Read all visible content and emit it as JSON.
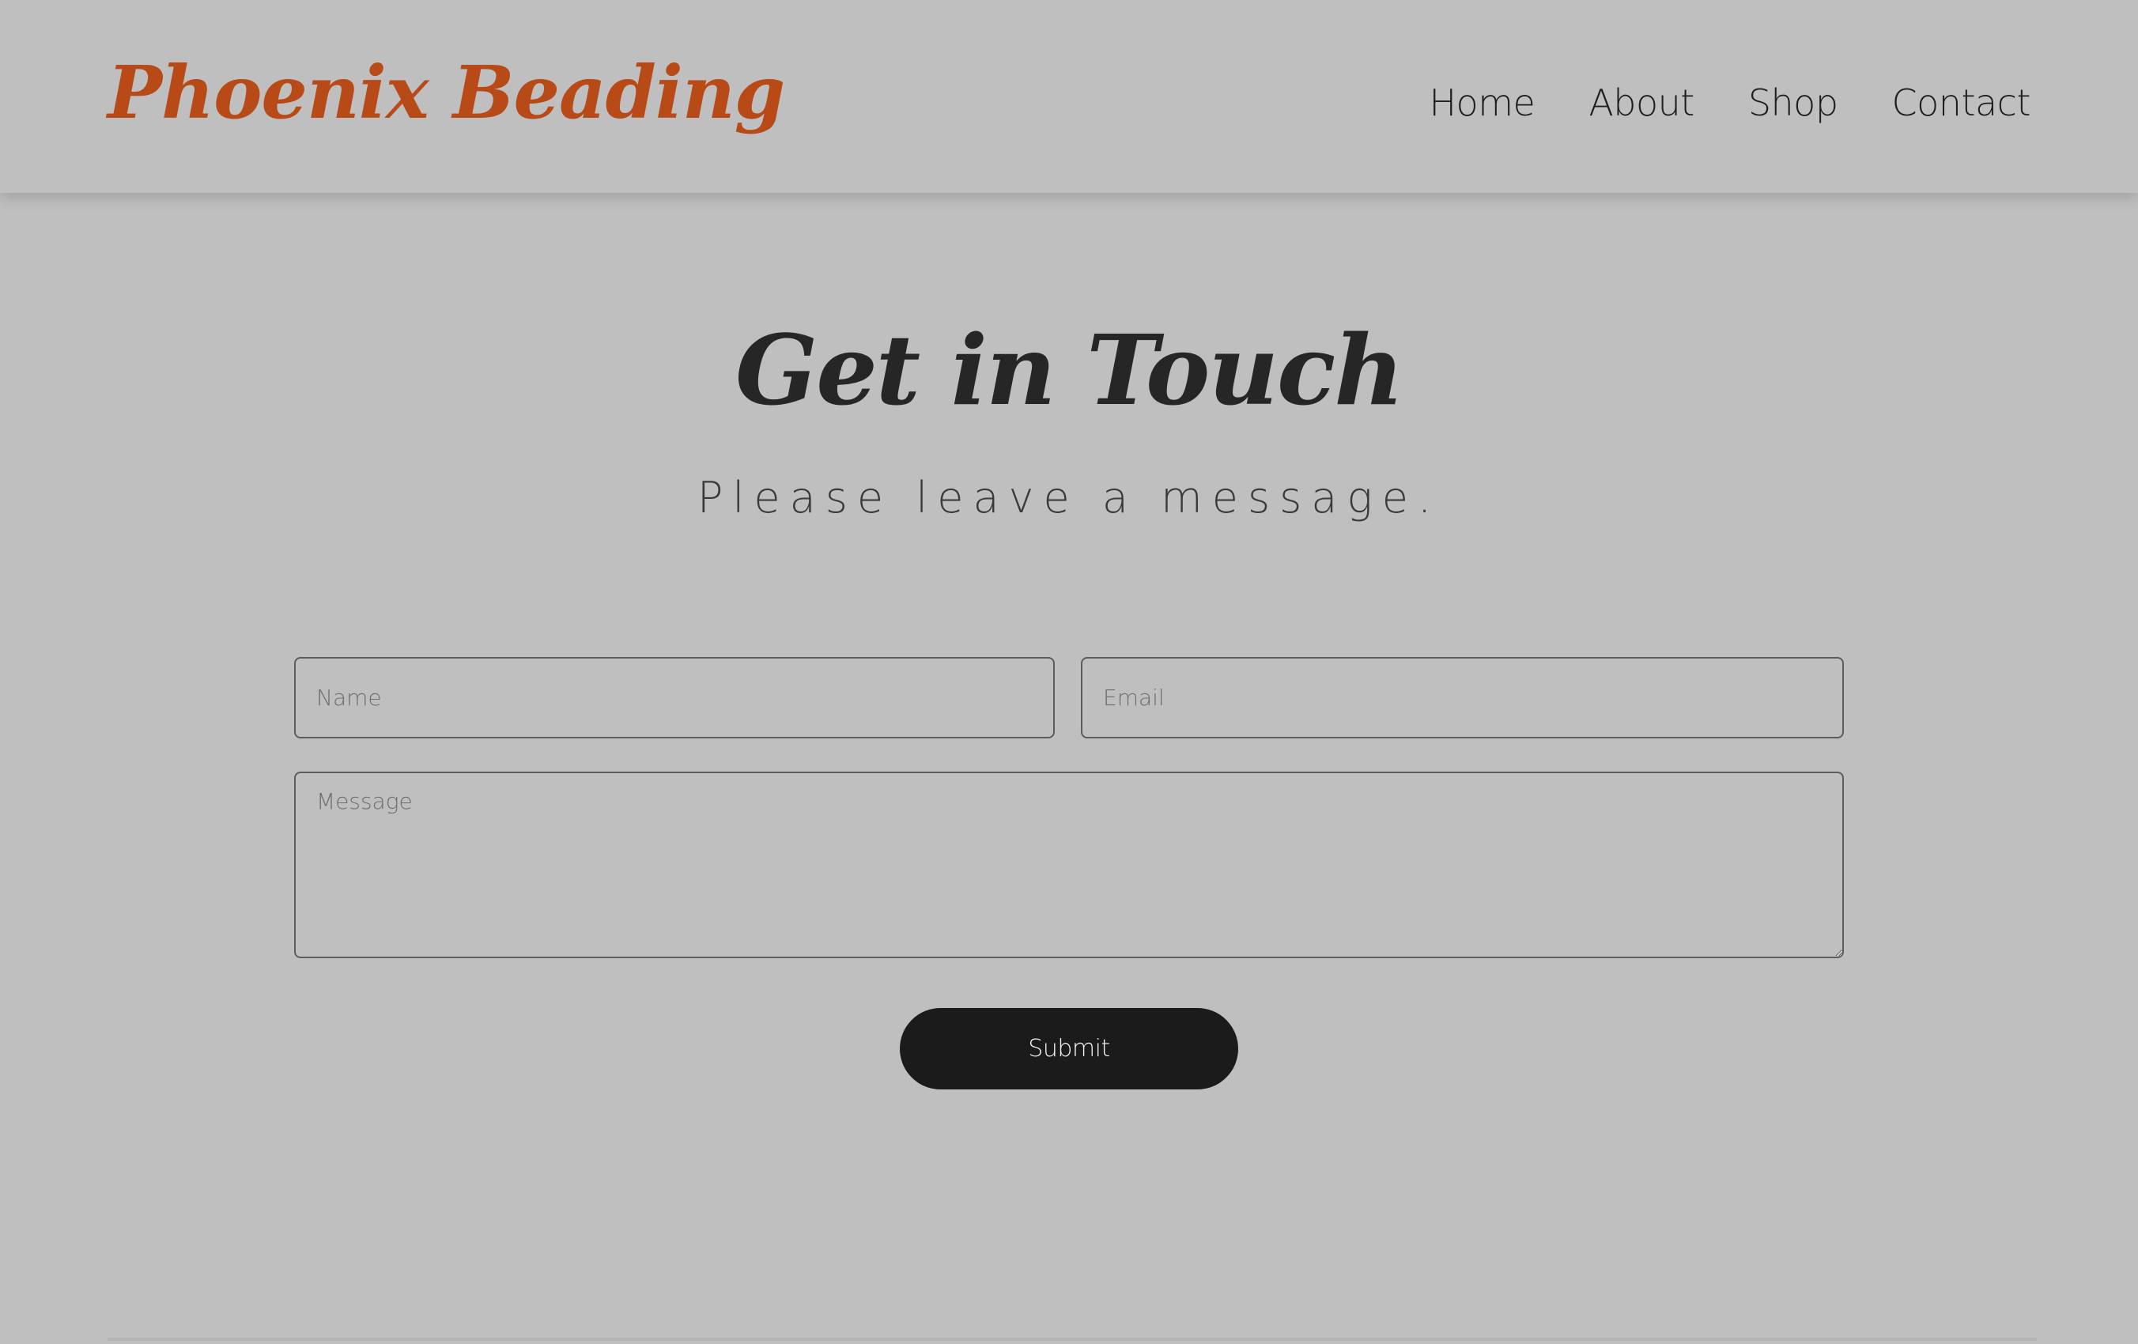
{
  "header": {
    "brand": "Phoenix Beading",
    "nav": [
      "Home",
      "About",
      "Shop",
      "Contact"
    ]
  },
  "main": {
    "title": "Get in Touch",
    "subtitle": "Please leave a message.",
    "form": {
      "name_placeholder": "Name",
      "email_placeholder": "Email",
      "message_placeholder": "Message",
      "submit_label": "Submit"
    }
  },
  "colors": {
    "background": "#bfbfbf",
    "brand": "#b84a18",
    "heading": "#262626",
    "button": "#1b1b1b",
    "button_text": "#f2f2f2"
  }
}
